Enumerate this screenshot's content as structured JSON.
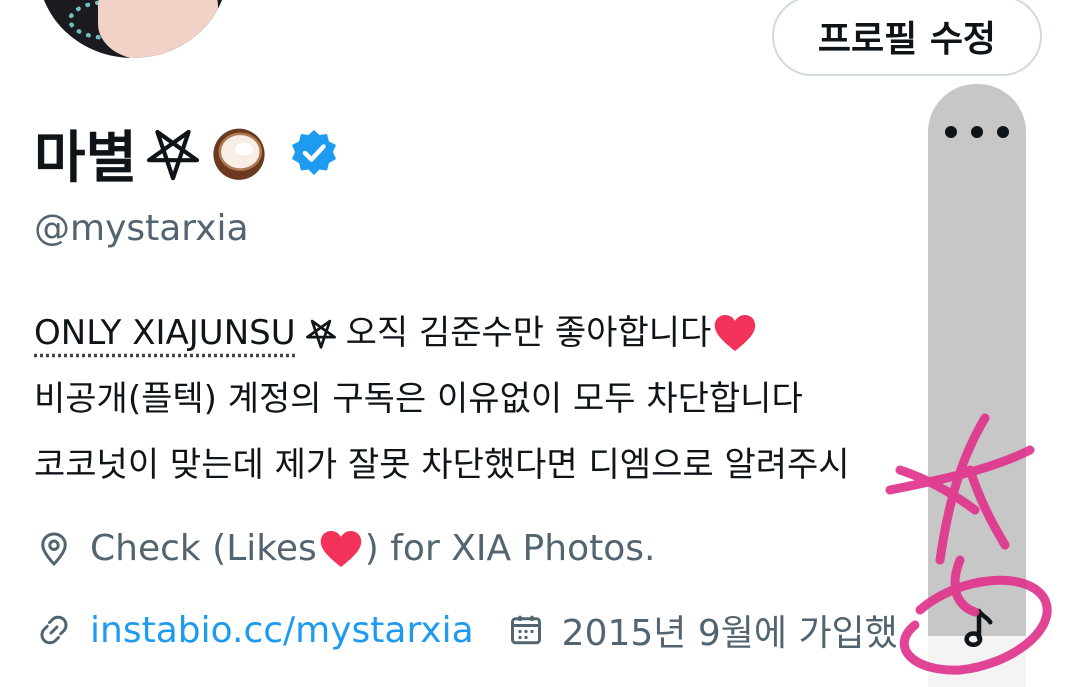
{
  "profile": {
    "edit_button_label": "프로필 수정",
    "display_name": "마별",
    "handle": "@mystarxia",
    "bio": {
      "line1_prefix": "ONLY XIAJUNSU",
      "line1_text": "오직 김준수만 좋아합니다",
      "line2": "비공개(플텍) 계정의 구독은 이유없이 모두 차단합니다",
      "line3": "코코넛이 맞는데 제가 잘못 차단했다면 디엠으로 알려주시"
    },
    "location_text": "Check (Likes",
    "location_suffix": ") for XIA Photos.",
    "website": "instabio.cc/mystarxia",
    "joined": "2015년 9월에 가입했"
  },
  "icons": {
    "verified": "verified-badge-icon",
    "location": "location-pin-icon",
    "link": "link-icon",
    "calendar": "calendar-icon",
    "more": "more-dots-icon",
    "music": "music-note-icon",
    "coconut": "coconut-emoji",
    "pentagram": "pentagram-icon",
    "heart": "red-heart-emoji"
  },
  "colors": {
    "text_primary": "#0f1419",
    "text_secondary": "#536471",
    "link": "#1d9bf0",
    "verified": "#1d9bf0",
    "scribble": "#e0348c"
  }
}
